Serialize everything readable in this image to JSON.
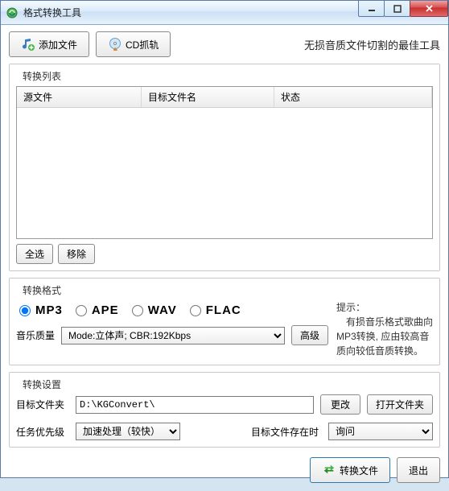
{
  "window": {
    "title": "格式转换工具"
  },
  "toolbar": {
    "add_file": "添加文件",
    "cd_rip": "CD抓轨",
    "slogan": "无损音质文件切割的最佳工具"
  },
  "list_section": {
    "legend": "转换列表",
    "cols": {
      "source": "源文件",
      "target": "目标文件名",
      "status": "状态"
    },
    "select_all": "全选",
    "remove": "移除"
  },
  "format_section": {
    "legend": "转换格式",
    "options": {
      "mp3": "MP3",
      "ape": "APE",
      "wav": "WAV",
      "flac": "FLAC"
    },
    "selected": "mp3",
    "quality_label": "音乐质量",
    "quality_value": "Mode:立体声; CBR:192Kbps",
    "advanced": "高级",
    "hint_title": "提示：",
    "hint_text": "有损音乐格式歌曲向MP3转换, 应由较高音质向较低音质转换。"
  },
  "settings_section": {
    "legend": "转换设置",
    "dest_label": "目标文件夹",
    "dest_value": "D:\\KGConvert\\",
    "change": "更改",
    "open_folder": "打开文件夹",
    "priority_label": "任务优先级",
    "priority_value": "加速处理（较快）",
    "exists_label": "目标文件存在时",
    "exists_value": "询问"
  },
  "footer": {
    "convert": "转换文件",
    "exit": "退出"
  }
}
